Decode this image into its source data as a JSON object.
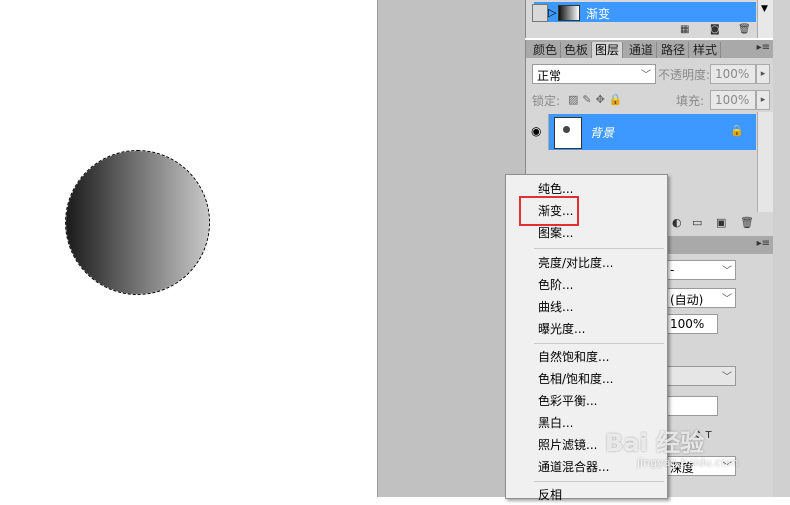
{
  "paths": {
    "item_label": "渐变",
    "arrow": "▷"
  },
  "layers": {
    "tabs": [
      "颜色",
      "色板",
      "图层",
      "通道",
      "路径",
      "样式"
    ],
    "active_tab": "图层",
    "blend_mode": "正常",
    "opacity_label": "不透明度:",
    "opacity_value": "100%",
    "lock_label": "锁定:",
    "fill_label": "填充:",
    "fill_value": "100%",
    "layer_name": "背景"
  },
  "properties": {
    "field_dash": "-",
    "auto_value": "(自动)",
    "percent_value": "100%",
    "depth_value": "深度"
  },
  "context_menu": {
    "items": [
      "纯色...",
      "渐变...",
      "图案...",
      "亮度/对比度...",
      "色阶...",
      "曲线...",
      "曝光度...",
      "自然饱和度...",
      "色相/饱和度...",
      "色彩平衡...",
      "黑白...",
      "照片滤镜...",
      "通道混合器...",
      "反相"
    ],
    "highlighted": "渐变..."
  },
  "watermark": {
    "text": "Bai 经验",
    "sub": "jingyan.baidu.com"
  },
  "colors": {
    "selection_blue": "#3d98ff",
    "highlight_red": "#e0302f",
    "panel_gray": "#d6d6d6"
  }
}
